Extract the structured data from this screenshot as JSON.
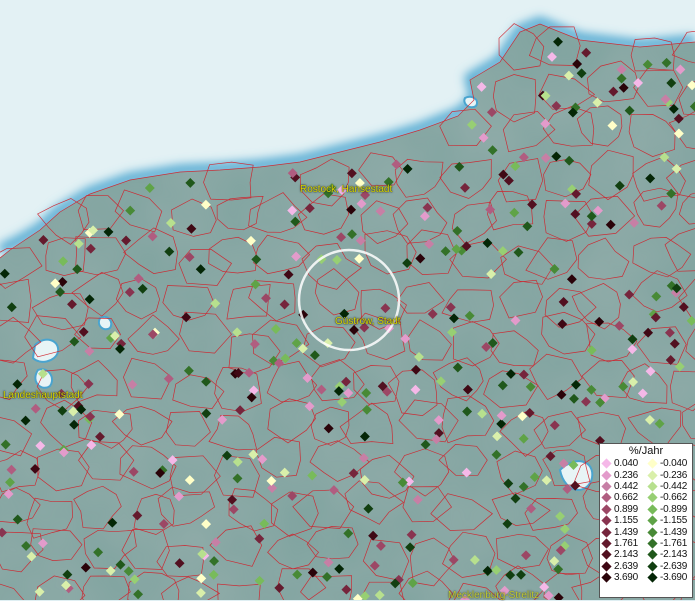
{
  "map": {
    "place_labels": [
      {
        "id": "rostock",
        "text": "Rostock, Hansestadt"
      },
      {
        "id": "guestrow",
        "text": "Güstrow, Stadt"
      },
      {
        "id": "landeshauptstadt",
        "text": "Landeshauptstadt"
      },
      {
        "id": "mecklenburg",
        "text": "Mecklenburg-Strelitz"
      }
    ],
    "colors": {
      "sea": "#e3f1f4",
      "land": "#7fa39f",
      "borders": "#d0202a",
      "labels": "#d8d800"
    }
  },
  "legend": {
    "title": "%/Jahr",
    "positive": [
      {
        "value": "0.040",
        "color": "#f5b8e8"
      },
      {
        "value": "0.236",
        "color": "#e39bcb"
      },
      {
        "value": "0.442",
        "color": "#c77fa5"
      },
      {
        "value": "0.662",
        "color": "#b05d80"
      },
      {
        "value": "0.899",
        "color": "#9c4765"
      },
      {
        "value": "1.155",
        "color": "#893450"
      },
      {
        "value": "1.439",
        "color": "#76253c"
      },
      {
        "value": "1.761",
        "color": "#641a2d"
      },
      {
        "value": "2.143",
        "color": "#521020"
      },
      {
        "value": "2.639",
        "color": "#3f0814"
      },
      {
        "value": "3.690",
        "color": "#2a0309"
      }
    ],
    "negative": [
      {
        "value": "-0.040",
        "color": "#ffffc8"
      },
      {
        "value": "-0.236",
        "color": "#d9efaa"
      },
      {
        "value": "-0.442",
        "color": "#b7e08e"
      },
      {
        "value": "-0.662",
        "color": "#97cf73"
      },
      {
        "value": "-0.899",
        "color": "#78bb5a"
      },
      {
        "value": "-1.155",
        "color": "#5fa347"
      },
      {
        "value": "-1.439",
        "color": "#488a36"
      },
      {
        "value": "-1.761",
        "color": "#337128"
      },
      {
        "value": "-2.143",
        "color": "#20581b"
      },
      {
        "value": "-2.639",
        "color": "#113f10"
      },
      {
        "value": "-3.690",
        "color": "#042606"
      }
    ]
  }
}
